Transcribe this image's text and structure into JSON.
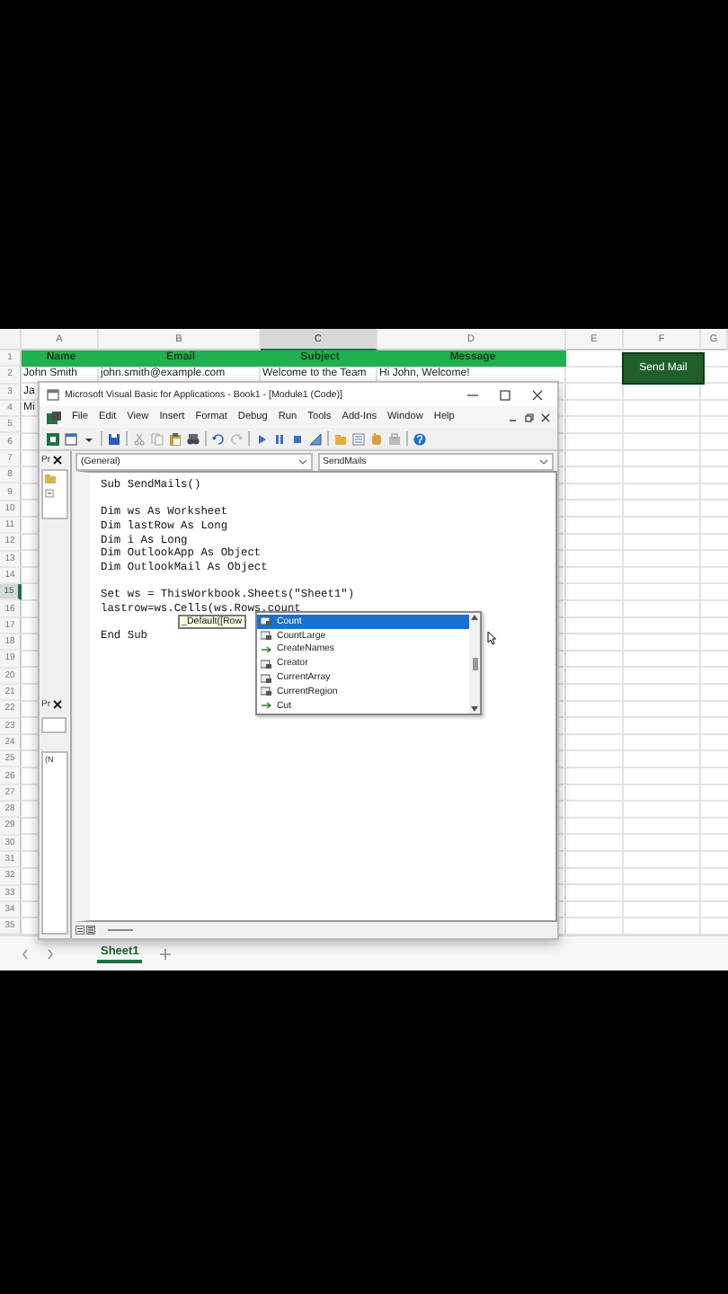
{
  "spreadsheet": {
    "columns": [
      {
        "label": "A",
        "selected": false
      },
      {
        "label": "B",
        "selected": false
      },
      {
        "label": "C",
        "selected": true
      },
      {
        "label": "D",
        "selected": false
      },
      {
        "label": "E",
        "selected": false
      },
      {
        "label": "F",
        "selected": false
      },
      {
        "label": "G",
        "selected": false
      }
    ],
    "rows": [
      {
        "label": "1",
        "selected": false,
        "kind": "header",
        "cells": [
          "Name",
          "Email",
          "Subject",
          "Message"
        ]
      },
      {
        "label": "2",
        "selected": false,
        "kind": "data",
        "cells": [
          "John Smith",
          "john.smith@example.com",
          "Welcome to the Team",
          "Hi John, Welcome!"
        ]
      },
      {
        "label": "3",
        "selected": false,
        "kind": "data",
        "cells": [
          "Ja"
        ]
      },
      {
        "label": "4",
        "selected": false,
        "kind": "data",
        "cells": [
          "Mi"
        ]
      },
      {
        "label": "5",
        "selected": false,
        "kind": "empty"
      },
      {
        "label": "6",
        "selected": false,
        "kind": "empty"
      },
      {
        "label": "7",
        "selected": false,
        "kind": "empty"
      },
      {
        "label": "8",
        "selected": false,
        "kind": "empty"
      },
      {
        "label": "9",
        "selected": false,
        "kind": "empty"
      },
      {
        "label": "10",
        "selected": false,
        "kind": "empty"
      },
      {
        "label": "11",
        "selected": false,
        "kind": "empty"
      },
      {
        "label": "12",
        "selected": false,
        "kind": "empty"
      },
      {
        "label": "13",
        "selected": false,
        "kind": "empty"
      },
      {
        "label": "14",
        "selected": false,
        "kind": "empty"
      },
      {
        "label": "15",
        "selected": true,
        "kind": "empty"
      },
      {
        "label": "16",
        "selected": false,
        "kind": "empty"
      },
      {
        "label": "17",
        "selected": false,
        "kind": "empty"
      },
      {
        "label": "18",
        "selected": false,
        "kind": "empty"
      },
      {
        "label": "19",
        "selected": false,
        "kind": "empty"
      },
      {
        "label": "20",
        "selected": false,
        "kind": "empty"
      },
      {
        "label": "21",
        "selected": false,
        "kind": "empty"
      },
      {
        "label": "22",
        "selected": false,
        "kind": "empty"
      },
      {
        "label": "23",
        "selected": false,
        "kind": "empty"
      },
      {
        "label": "24",
        "selected": false,
        "kind": "empty"
      },
      {
        "label": "25",
        "selected": false,
        "kind": "empty"
      },
      {
        "label": "26",
        "selected": false,
        "kind": "empty"
      },
      {
        "label": "27",
        "selected": false,
        "kind": "empty"
      },
      {
        "label": "28",
        "selected": false,
        "kind": "empty"
      },
      {
        "label": "29",
        "selected": false,
        "kind": "empty"
      },
      {
        "label": "30",
        "selected": false,
        "kind": "empty"
      },
      {
        "label": "31",
        "selected": false,
        "kind": "empty"
      },
      {
        "label": "32",
        "selected": false,
        "kind": "empty"
      },
      {
        "label": "33",
        "selected": false,
        "kind": "empty"
      },
      {
        "label": "34",
        "selected": false,
        "kind": "empty"
      },
      {
        "label": "35",
        "selected": false,
        "kind": "empty"
      }
    ]
  },
  "send_button": {
    "label": "Send Mail"
  },
  "vba_window": {
    "title": "Microsoft Visual Basic for Applications - Book1 - [Module1 (Code)]",
    "menu": [
      "File",
      "Edit",
      "View",
      "Insert",
      "Format",
      "Debug",
      "Run",
      "Tools",
      "Add-Ins",
      "Window",
      "Help"
    ],
    "project_pane": {
      "title": "Pr"
    },
    "properties_pane": {
      "title": "Pr",
      "list_item": "(N"
    },
    "code_window": {
      "object_combo": "(General)",
      "procedure_combo": "SendMails",
      "code_blocks": [
        [
          "Sub SendMails()"
        ],
        [
          "Dim ws As Worksheet",
          "Dim lastRow As Long",
          "Dim i As Long",
          "Dim OutlookApp As Object",
          "Dim OutlookMail As Object"
        ],
        [
          "Set ws = ThisWorkbook.Sheets(\"Sheet1\")",
          "lastrow=ws.Cells(ws.Rows.count"
        ],
        [
          "End Sub"
        ]
      ],
      "parameter_tip": "_Default([Row",
      "completion_list": [
        {
          "label": "Count",
          "kind": "property",
          "selected": true
        },
        {
          "label": "CountLarge",
          "kind": "property",
          "selected": false
        },
        {
          "label": "CreateNames",
          "kind": "method",
          "selected": false
        },
        {
          "label": "Creator",
          "kind": "property",
          "selected": false
        },
        {
          "label": "CurrentArray",
          "kind": "property",
          "selected": false
        },
        {
          "label": "CurrentRegion",
          "kind": "property",
          "selected": false
        },
        {
          "label": "Cut",
          "kind": "method",
          "selected": false
        }
      ]
    }
  },
  "sheet_tabs": [
    {
      "label": "Sheet1",
      "selected": true
    }
  ]
}
